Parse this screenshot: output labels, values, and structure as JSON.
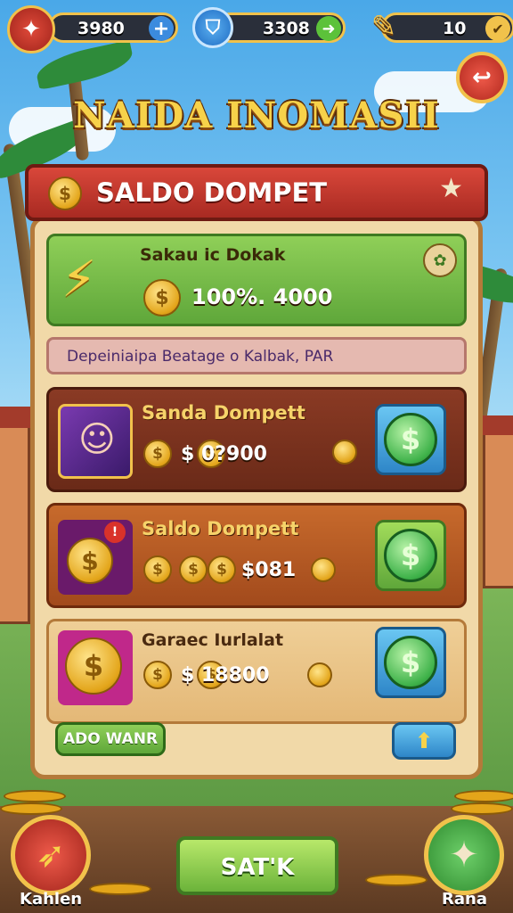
{
  "top_bar": {
    "left_value": "3980",
    "mid_value": "3308",
    "right_value": "10",
    "left_plus_icon": "plus-icon",
    "mid_plus_icon": "plus-icon",
    "right_plus_icon": "chevron-down-icon"
  },
  "header": {
    "title": "NAIDA INOMASII"
  },
  "panel": {
    "banner_title": "SALDO DOMPET",
    "featured": {
      "label": "Sakau ic Dokak",
      "value": "100%. 4000"
    },
    "info_strip": "Depeiniaipa Beatage o Kalbak, PAR",
    "items": [
      {
        "title": "Sanda Dompett",
        "value": "$ 0?900",
        "currency": "$"
      },
      {
        "title": "Saldo Dompett",
        "value": "$081",
        "currency": "$"
      },
      {
        "title": "Garaec Iurlalat",
        "value": "$ 18800",
        "currency": "$"
      }
    ],
    "footer_left_button": "ADO WANR",
    "footer_right_icon": "arrow-up-icon"
  },
  "bottom_bar": {
    "main_button": "SAT'K",
    "left_label": "Kahlen",
    "right_label": "Rana"
  },
  "colors": {
    "accent_gold": "#f1c24b",
    "banner_red": "#c9372c",
    "panel_bg": "#f1d9a8"
  }
}
